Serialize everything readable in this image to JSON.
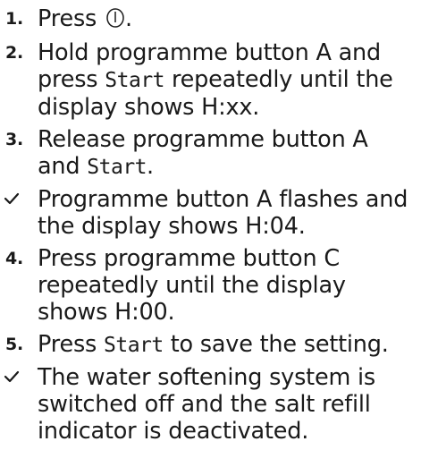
{
  "steps": [
    {
      "marker": "1.",
      "text_before": "Press",
      "icon": "power-icon",
      "text_after": "."
    },
    {
      "marker": "2.",
      "text_1": "Hold programme button A and press",
      "start_label": "Start",
      "text_2": "repeatedly until the display shows",
      "display_value": "H:xx."
    },
    {
      "marker": "3.",
      "text_1": "Release programme button A and",
      "start_label": "Start",
      "text_2": "."
    },
    {
      "marker_icon": "check-icon",
      "text": "Programme button A flashes and the display shows H:04."
    },
    {
      "marker": "4.",
      "text": "Press programme button C repeatedly until the display shows H:00."
    },
    {
      "marker": "5.",
      "text_before": "Press",
      "start_label": "Start",
      "text_after": "to save the setting."
    },
    {
      "marker_icon": "check-icon",
      "text": "The water softening system is switched off and the salt refill indicator is deactivated."
    }
  ]
}
